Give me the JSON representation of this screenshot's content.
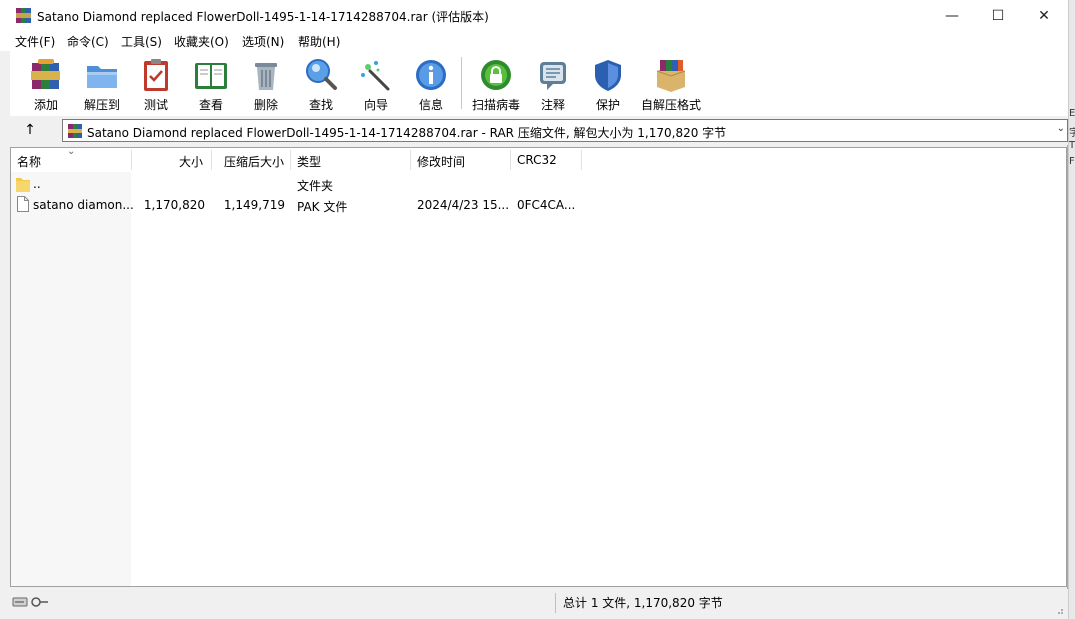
{
  "window": {
    "title": "Satano Diamond replaced FlowerDoll-1495-1-14-1714288704.rar (评估版本)",
    "minimize": "—",
    "maximize": "☐",
    "close": "✕"
  },
  "menu": [
    {
      "label": "文件(F)"
    },
    {
      "label": "命令(C)"
    },
    {
      "label": "工具(S)"
    },
    {
      "label": "收藏夹(O)"
    },
    {
      "label": "选项(N)"
    },
    {
      "label": "帮助(H)"
    }
  ],
  "toolbar": [
    {
      "label": "添加",
      "icon": "add-archive-icon"
    },
    {
      "label": "解压到",
      "icon": "extract-folder-icon"
    },
    {
      "label": "测试",
      "icon": "test-clipboard-icon"
    },
    {
      "label": "查看",
      "icon": "view-book-icon"
    },
    {
      "label": "删除",
      "icon": "delete-trash-icon"
    },
    {
      "label": "查找",
      "icon": "find-magnifier-icon"
    },
    {
      "label": "向导",
      "icon": "wizard-wand-icon"
    },
    {
      "label": "信息",
      "icon": "info-icon"
    },
    {
      "label": "扫描病毒",
      "icon": "virus-scan-icon"
    },
    {
      "label": "注释",
      "icon": "comment-icon"
    },
    {
      "label": "保护",
      "icon": "protect-shield-icon"
    },
    {
      "label": "自解压格式",
      "icon": "sfx-box-icon"
    }
  ],
  "address": {
    "up": "↑",
    "text": "Satano Diamond replaced FlowerDoll-1495-1-14-1714288704.rar - RAR 压缩文件, 解包大小为 1,170,820 字节",
    "dropdown": "⌄"
  },
  "columns": {
    "name": "名称",
    "size": "大小",
    "packed": "压缩后大小",
    "type": "类型",
    "modified": "修改时间",
    "crc": "CRC32",
    "sort_indicator": "⌄"
  },
  "rows": [
    {
      "name": "..",
      "size": "",
      "packed": "",
      "type": "文件夹",
      "modified": "",
      "crc": ""
    },
    {
      "name": "satano diamon...",
      "size": "1,170,820",
      "packed": "1,149,719",
      "type": "PAK 文件",
      "modified": "2024/4/23 15...",
      "crc": "0FC4CA..."
    }
  ],
  "status": {
    "text": "总计 1 文件, 1,170,820 字节"
  },
  "side_strip": [
    "E",
    "字",
    "T",
    "FO"
  ],
  "colors": {
    "accent_blue": "#2b6cc4",
    "folder_yellow": "#f3c94b"
  }
}
